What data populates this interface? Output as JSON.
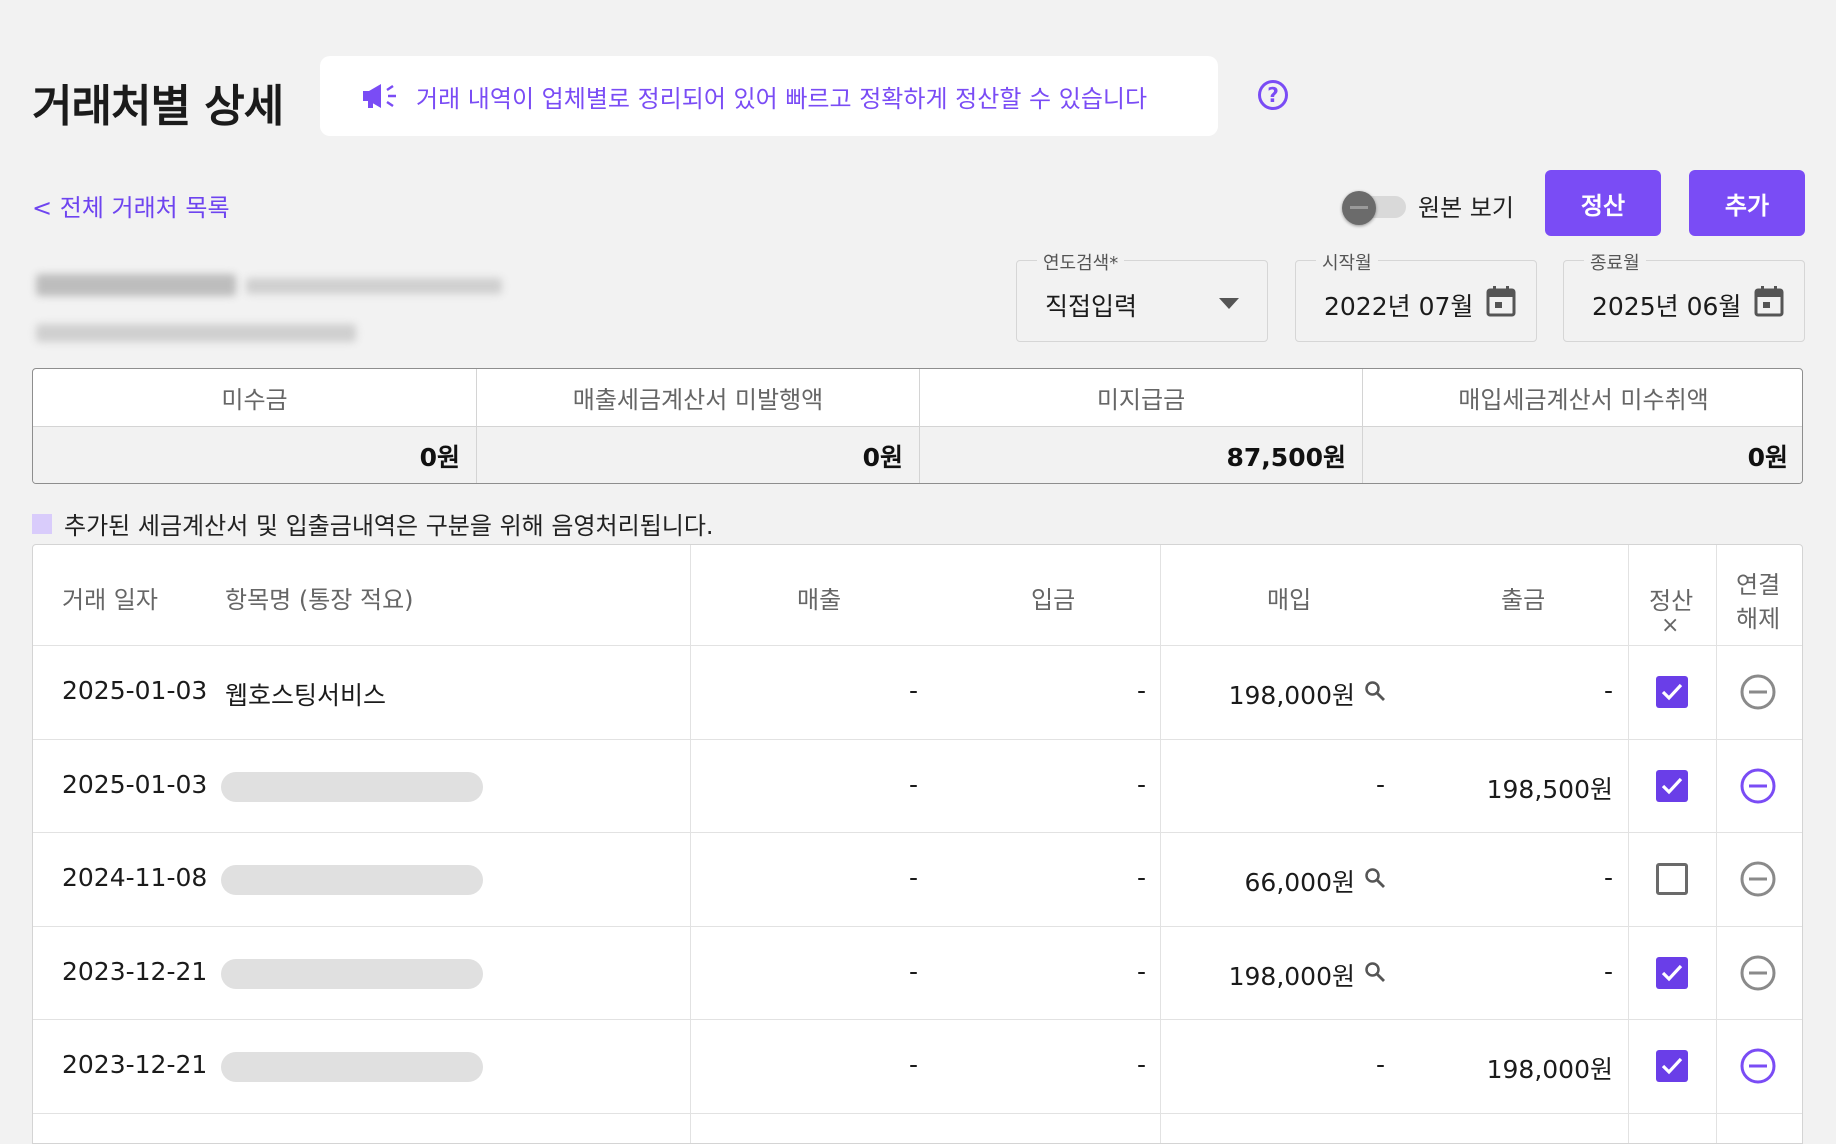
{
  "header": {
    "title": "거래처별 상세",
    "notice": "거래 내역이 업체별로 정리되어 있어 빠르고 정확하게 정산할 수 있습니다",
    "help_symbol": "?",
    "accent_color": "#7a4cf5"
  },
  "nav": {
    "back_link": "< 전체 거래처 목록"
  },
  "toolbar": {
    "toggle_label": "원본 보기",
    "toggle_on": false,
    "settle_button": "정산",
    "add_button": "추가"
  },
  "filters": {
    "year_search": {
      "label": "연도검색*",
      "value": "직접입력"
    },
    "start_month": {
      "label": "시작월",
      "value": "2022년 07월"
    },
    "end_month": {
      "label": "종료월",
      "value": "2025년 06월"
    }
  },
  "summary": {
    "columns": [
      {
        "label": "미수금",
        "value": "0원"
      },
      {
        "label": "매출세금계산서 미발행액",
        "value": "0원"
      },
      {
        "label": "미지급금",
        "value": "87,500원"
      },
      {
        "label": "매입세금계산서 미수취액",
        "value": "0원"
      }
    ]
  },
  "legend": {
    "text": "추가된 세금계산서 및 입출금내역은 구분을 위해 음영처리됩니다.",
    "swatch_color": "#d9ccfb"
  },
  "table": {
    "headers": {
      "date": "거래 일자",
      "item": "항목명 (통장 적요)",
      "sales": "매출",
      "deposit": "입금",
      "purchase": "매입",
      "withdrawal": "출금",
      "settle": "정산",
      "settle_clear": "×",
      "unlink_1": "연결",
      "unlink_2": "해제"
    },
    "rows": [
      {
        "date": "2025-01-03",
        "item": "웹호스팅서비스",
        "item_blurred": false,
        "sales": "-",
        "deposit": "-",
        "purchase": "198,000원",
        "purchase_search": true,
        "withdrawal": "-",
        "settled": true,
        "unlink_active": false
      },
      {
        "date": "2025-01-03",
        "item": "",
        "item_blurred": true,
        "sales": "-",
        "deposit": "-",
        "purchase": "-",
        "purchase_search": false,
        "withdrawal": "198,500원",
        "settled": true,
        "unlink_active": true
      },
      {
        "date": "2024-11-08",
        "item": "",
        "item_blurred": true,
        "sales": "-",
        "deposit": "-",
        "purchase": "66,000원",
        "purchase_search": true,
        "withdrawal": "-",
        "settled": false,
        "unlink_active": false
      },
      {
        "date": "2023-12-21",
        "item": "",
        "item_blurred": true,
        "sales": "-",
        "deposit": "-",
        "purchase": "198,000원",
        "purchase_search": true,
        "withdrawal": "-",
        "settled": true,
        "unlink_active": false
      },
      {
        "date": "2023-12-21",
        "item": "",
        "item_blurred": true,
        "sales": "-",
        "deposit": "-",
        "purchase": "-",
        "purchase_search": false,
        "withdrawal": "198,000원",
        "settled": true,
        "unlink_active": true
      }
    ]
  }
}
